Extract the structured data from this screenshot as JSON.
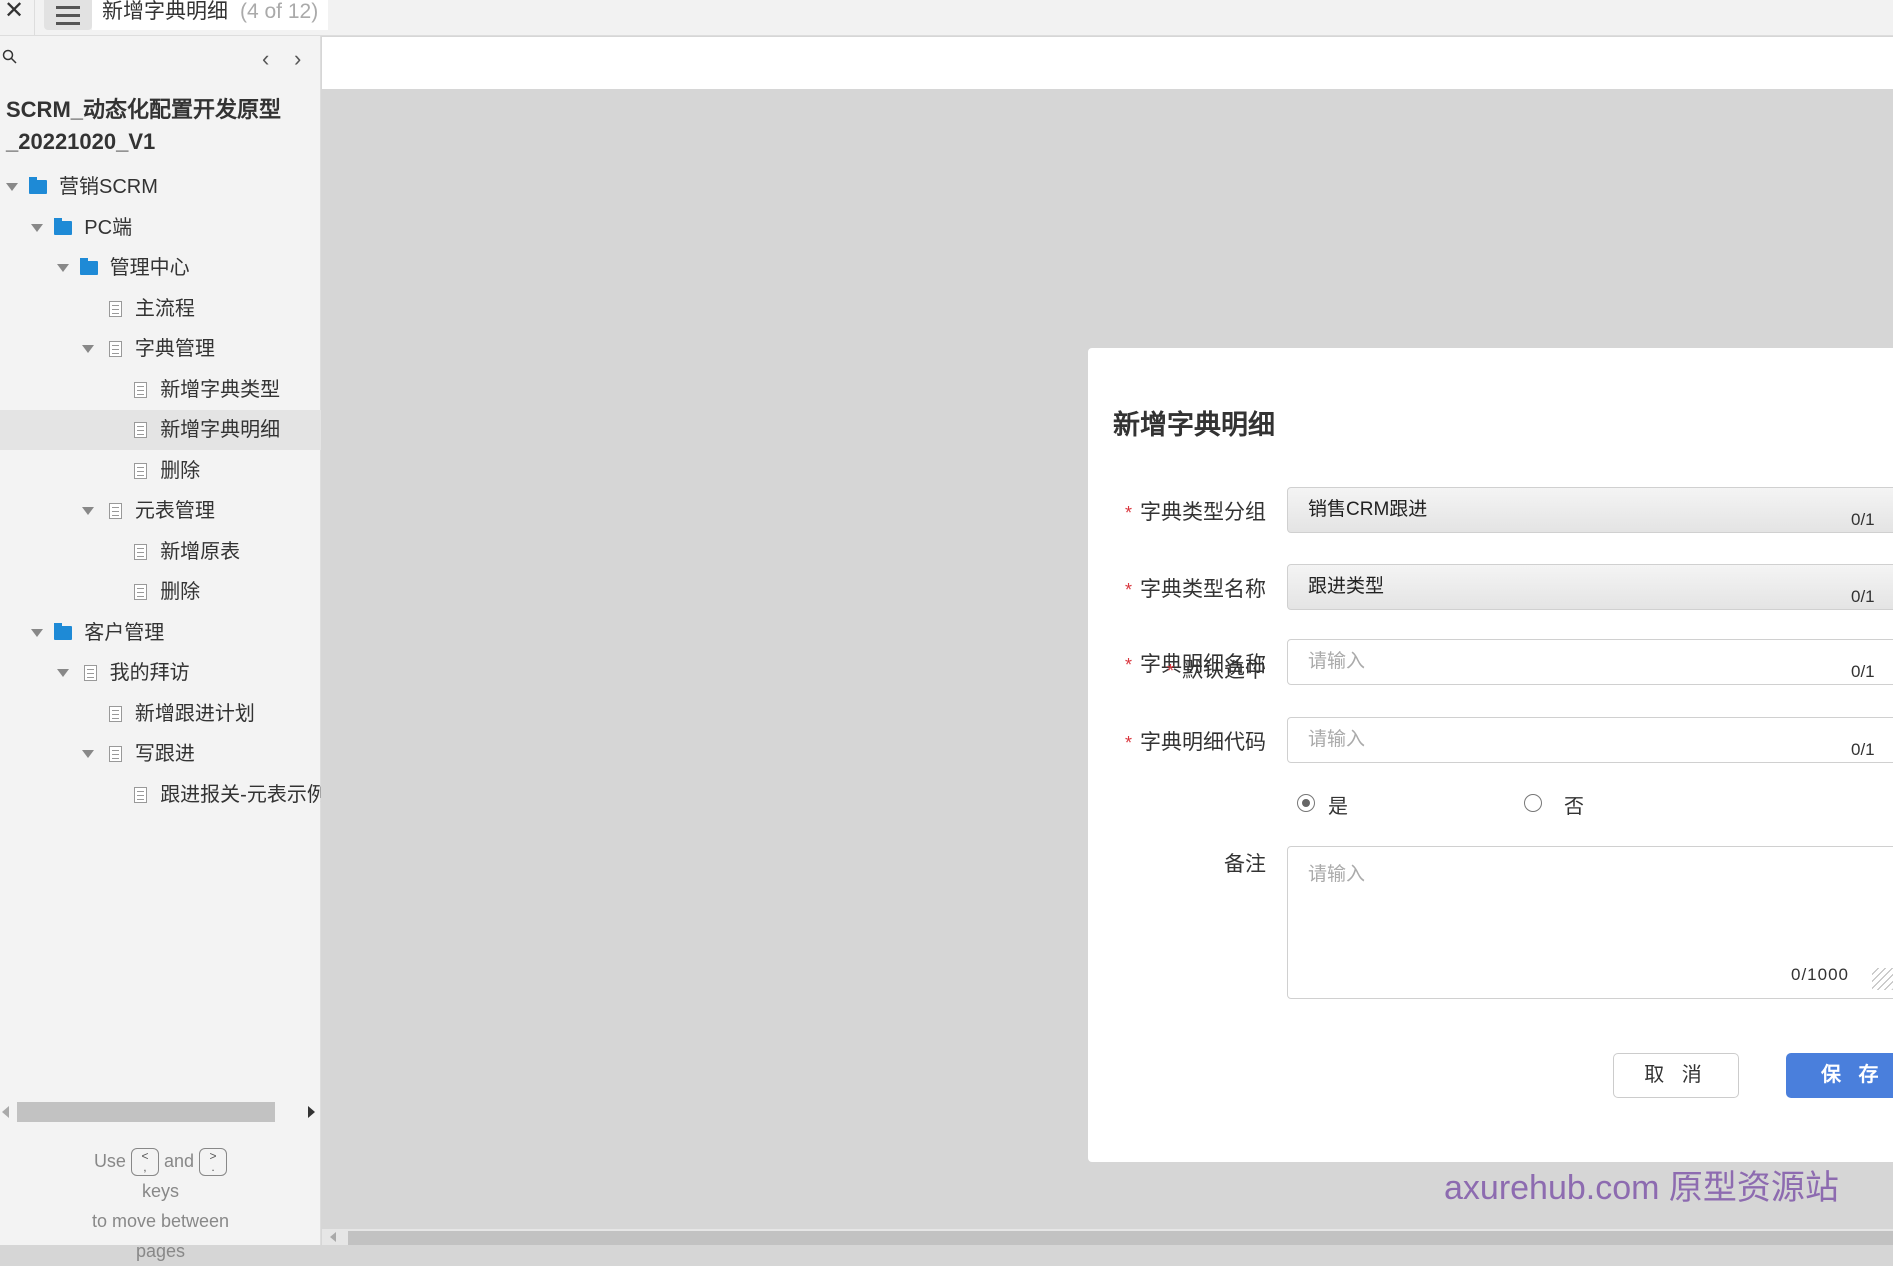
{
  "topbar": {
    "page_title": "新增字典明细",
    "page_count": "(4 of 12)"
  },
  "sidebar": {
    "project_title_line1": "SCRM_动态化配置开发原型",
    "project_title_line2": "_20221020_V1",
    "tree": [
      {
        "label": "营销SCRM",
        "level": 0,
        "expanded": true,
        "icon": "folder-icon"
      },
      {
        "label": "PC端",
        "level": 1,
        "expanded": true,
        "icon": "folder-icon"
      },
      {
        "label": "管理中心",
        "level": 2,
        "expanded": true,
        "icon": "folder-icon"
      },
      {
        "label": "主流程",
        "level": 3,
        "icon": "page-icon"
      },
      {
        "label": "字典管理",
        "level": 3,
        "expanded": true,
        "icon": "page-icon"
      },
      {
        "label": "新增字典类型",
        "level": 4,
        "icon": "page-icon"
      },
      {
        "label": "新增字典明细",
        "level": 4,
        "icon": "page-icon",
        "selected": true
      },
      {
        "label": "删除",
        "level": 4,
        "icon": "page-icon"
      },
      {
        "label": "元表管理",
        "level": 3,
        "expanded": true,
        "icon": "page-icon"
      },
      {
        "label": "新增原表",
        "level": 4,
        "icon": "page-icon"
      },
      {
        "label": "删除",
        "level": 4,
        "icon": "page-icon"
      },
      {
        "label": "客户管理",
        "level": 1,
        "expanded": true,
        "icon": "folder-icon"
      },
      {
        "label": "我的拜访",
        "level": 2,
        "expanded": true,
        "icon": "page-icon"
      },
      {
        "label": "新增跟进计划",
        "level": 3,
        "icon": "page-icon"
      },
      {
        "label": "写跟进",
        "level": 3,
        "expanded": true,
        "icon": "page-icon"
      },
      {
        "label": "跟进报关-元表示例",
        "level": 4,
        "icon": "page-icon"
      }
    ],
    "help": {
      "use": "Use",
      "key_prev": "<\n,",
      "and": "and",
      "key_next": ">\n.",
      "keys": "keys",
      "line2": "to move between",
      "line3": "pages"
    }
  },
  "modal": {
    "title": "新增字典明细",
    "fields": [
      {
        "label": "字典类型分组",
        "required": true,
        "value": "销售CRM跟进",
        "disabled": true,
        "counter": "0/1"
      },
      {
        "label": "字典类型名称",
        "required": true,
        "value": "跟进类型",
        "disabled": true,
        "counter": "0/1"
      },
      {
        "label": "字典明细名称",
        "required": true,
        "placeholder": "请输入",
        "counter": "0/1"
      },
      {
        "label": "字典明细代码",
        "required": true,
        "placeholder": "请输入",
        "counter": "0/1"
      }
    ],
    "default_selected": {
      "label": "默认选中",
      "required": true,
      "options": [
        "是",
        "否"
      ],
      "selected": "是"
    },
    "remark": {
      "label": "备注",
      "placeholder": "请输入",
      "counter": "0/1000"
    },
    "cancel_label": "取 消",
    "save_label": "保 存",
    "accent": "#4a7fdc"
  },
  "watermark": "axurehub.com 原型资源站"
}
